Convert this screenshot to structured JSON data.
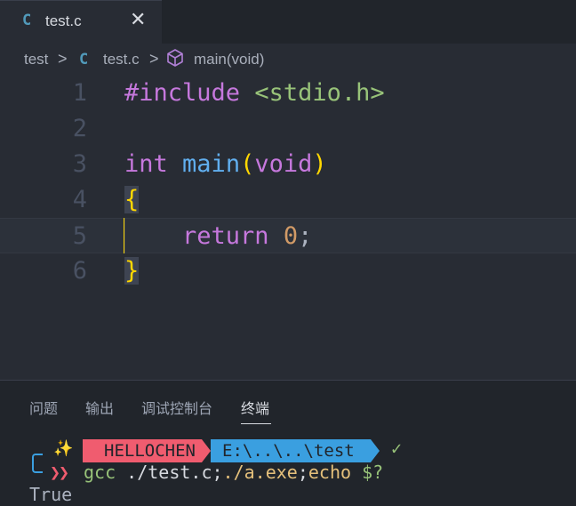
{
  "tab": {
    "icon": "C",
    "label": "test.c",
    "close": "✕"
  },
  "breadcrumb": {
    "folder": "test",
    "sep": ">",
    "file_icon": "C",
    "file": "test.c",
    "symbol": "main(void)",
    "symbol_icon": "cube-icon"
  },
  "editor": {
    "line_numbers": [
      "1",
      "2",
      "3",
      "4",
      "5",
      "6"
    ],
    "lines": {
      "l1_kw": "#include",
      "l1_str": "<stdio.h>",
      "l3_type": "int",
      "l3_fn": "main",
      "l3_open": "(",
      "l3_param": "void",
      "l3_close": ")",
      "l4_brace": "{",
      "l5_indent": "    ",
      "l5_kw": "return",
      "l5_num": "0",
      "l5_semi": ";",
      "l6_brace": "}"
    }
  },
  "panel": {
    "tabs": [
      "问题",
      "输出",
      "调试控制台",
      "终端"
    ],
    "active": "终端"
  },
  "terminal": {
    "icon": "✨",
    "user": "HELLOCHEN",
    "path": "E:\\..\\..\\test",
    "status": "✓",
    "prompt": "❯❯",
    "cmd_gcc": "gcc",
    "cmd_arg": " ./test.c;",
    "cmd_exe": "./a.exe",
    "cmd_semi": ";",
    "cmd_echo": "echo",
    "cmd_var": " $?",
    "output": "True"
  },
  "colors": {
    "accent_blue": "#3a9fe0",
    "accent_red": "#f05c6f",
    "editor_bg": "#282c34"
  }
}
